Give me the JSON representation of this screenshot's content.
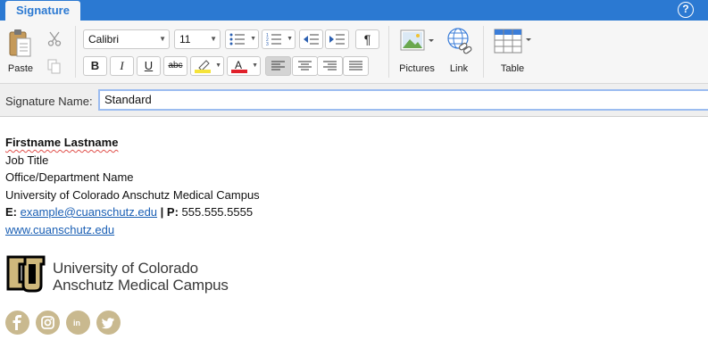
{
  "tab": {
    "label": "Signature"
  },
  "help": {
    "label": "?"
  },
  "ribbon": {
    "paste_label": "Paste",
    "font_name": "Calibri",
    "font_size": "11",
    "bold": "B",
    "italic": "I",
    "underline": "U",
    "strikethrough": "abc",
    "pictures_label": "Pictures",
    "link_label": "Link",
    "table_label": "Table",
    "highlight_color": "#f5e33a",
    "font_color": "#e0202a",
    "accent": "#2b79d2"
  },
  "signature_name": {
    "label": "Signature Name:",
    "value": "Standard"
  },
  "signature": {
    "name": "Firstname Lastname",
    "job_title": "Job Title",
    "office": "Office/Department Name",
    "institution": "University of Colorado Anschutz Medical Campus",
    "email_prefix": "E:",
    "email": "example@cuanschutz.edu",
    "separator": "|",
    "phone_prefix": "P:",
    "phone": "555.555.5555",
    "website": "www.cuanschutz.edu",
    "logo_line1": "University of Colorado",
    "logo_line2": "Anschutz Medical Campus",
    "social": [
      "facebook-icon",
      "instagram-icon",
      "linkedin-icon",
      "twitter-icon"
    ],
    "social_color": "#c9b98f"
  }
}
